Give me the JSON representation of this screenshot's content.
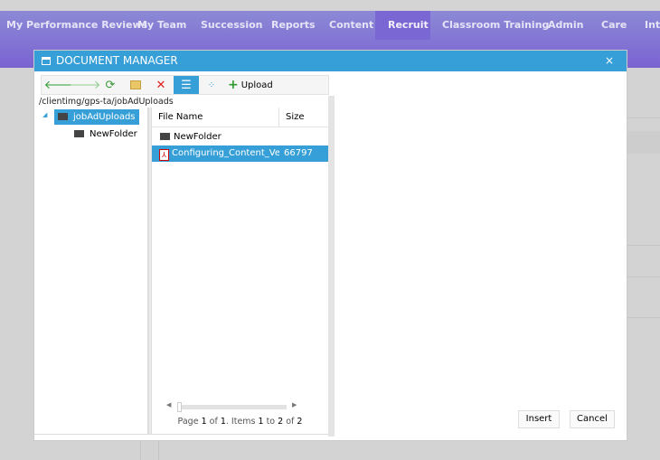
{
  "nav": {
    "items": [
      "My Performance Reviews",
      "My Team",
      "Succession",
      "Reports",
      "Content",
      "Recruit",
      "Classroom Training",
      "Admin",
      "Care",
      "Inte"
    ],
    "active": "Recruit"
  },
  "dialog": {
    "title": "DOCUMENT MANAGER",
    "close": "×",
    "toolbar": {
      "icons": [
        "back-arrow-icon",
        "forward-arrow-icon",
        "refresh-icon",
        "new-folder-icon",
        "delete-icon",
        "list-view-icon",
        "thumbnail-view-icon"
      ],
      "upload": "Upload"
    },
    "path": "/clientimg/gps-ta/jobAdUploads",
    "tree": {
      "root": "jobAdUploads",
      "children": [
        "NewFolder"
      ]
    },
    "grid": {
      "headers": [
        "File Name",
        "Size"
      ],
      "rows": [
        {
          "name": "NewFolder",
          "size": "",
          "type": "folder"
        },
        {
          "name": "Configuring_Content_Vendors",
          "size": "66797",
          "type": "pdf",
          "selected": true
        }
      ]
    },
    "pager": {
      "p1": "Page ",
      "page": "1",
      "p2": " of ",
      "pages": "1",
      "p3": ". Items ",
      "from": "1",
      "p4": " to ",
      "to": "2",
      "p5": " of ",
      "total": "2"
    },
    "insert": "Insert",
    "cancel": "Cancel"
  },
  "colors": {
    "nav": "#8069d3",
    "accent": "#379fd8"
  }
}
